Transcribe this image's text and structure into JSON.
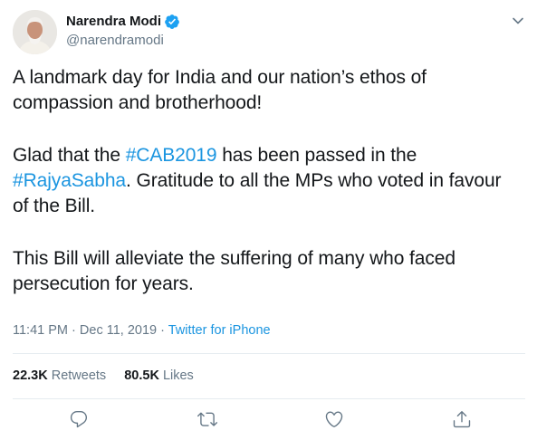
{
  "author": {
    "display_name": "Narendra Modi",
    "handle": "@narendramodi",
    "verified": true
  },
  "tweet": {
    "p1": "A landmark day for India and our nation’s ethos of compassion and brotherhood!",
    "p2_a": "Glad that the ",
    "p2_tag1": "#CAB2019",
    "p2_b": " has been passed in the ",
    "p2_tag2": "#RajyaSabha",
    "p2_c": ". Gratitude to all the MPs who voted in favour of the Bill.",
    "p3": "This Bill will alleviate the suffering of many who faced persecution for years."
  },
  "meta": {
    "time": "11:41 PM",
    "date": "Dec 11, 2019",
    "separator": "·",
    "source": "Twitter for iPhone"
  },
  "stats": {
    "retweets_count": "22.3K",
    "retweets_label": "Retweets",
    "likes_count": "80.5K",
    "likes_label": "Likes"
  },
  "colors": {
    "text": "#14171a",
    "secondary": "#657786",
    "link": "#1b95e0",
    "verified": "#1da1f2",
    "divider": "#e6ecf0"
  },
  "icons": {
    "verified": "verified-badge-icon",
    "caret": "chevron-down-icon",
    "reply": "reply-icon",
    "retweet": "retweet-icon",
    "like": "heart-icon",
    "share": "share-icon"
  }
}
